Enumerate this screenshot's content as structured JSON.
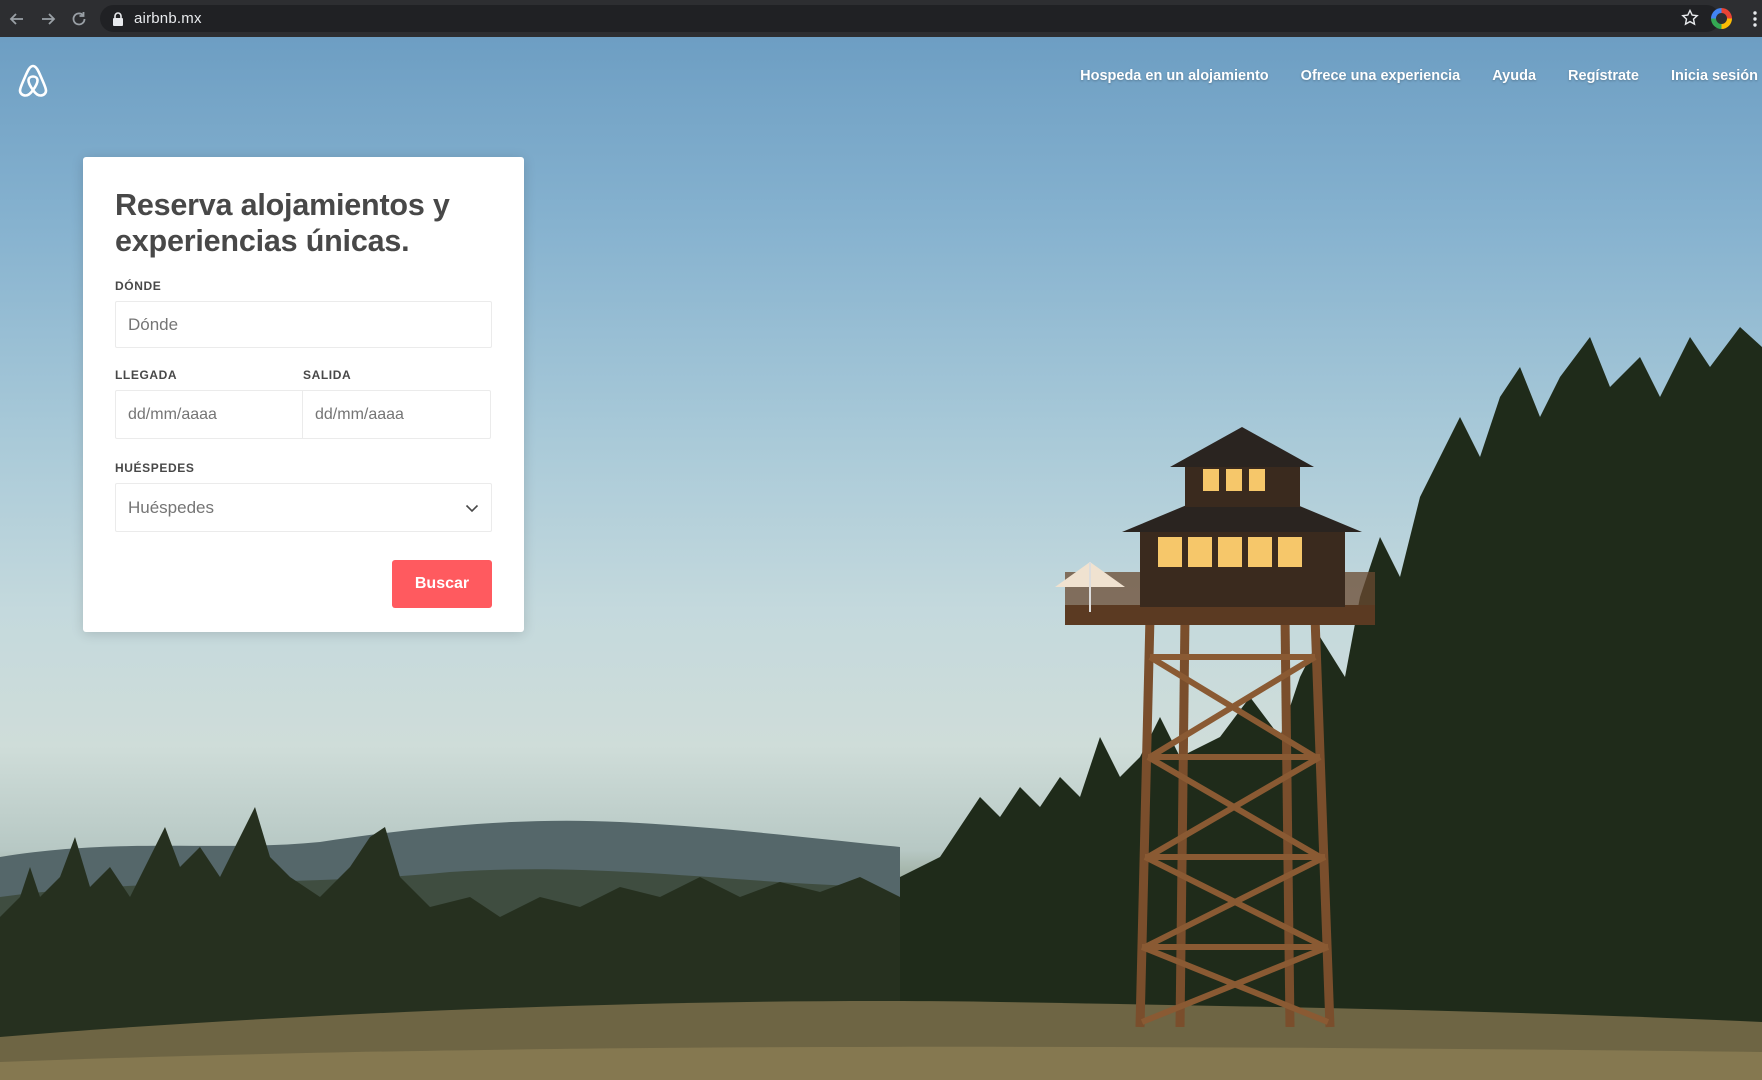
{
  "browser": {
    "url": "airbnb.mx",
    "back_icon": "arrow-left-icon",
    "forward_icon": "arrow-right-icon",
    "reload_icon": "reload-icon",
    "lock_icon": "lock-icon",
    "star_icon": "star-icon",
    "menu_icon": "vertical-dots-icon"
  },
  "header": {
    "logo_icon": "airbnb-belo-icon",
    "nav": [
      {
        "label": "Hospeda en un alojamiento"
      },
      {
        "label": "Ofrece una experiencia"
      },
      {
        "label": "Ayuda"
      },
      {
        "label": "Regístrate"
      },
      {
        "label": "Inicia sesión"
      }
    ]
  },
  "search": {
    "title": "Reserva alojamientos y experiencias únicas.",
    "where_label": "DÓNDE",
    "where_placeholder": "Dónde",
    "checkin_label": "LLEGADA",
    "checkin_placeholder": "dd/mm/aaaa",
    "checkout_label": "SALIDA",
    "checkout_placeholder": "dd/mm/aaaa",
    "guests_label": "HUÉSPEDES",
    "guests_value": "Huéspedes",
    "submit_label": "Buscar"
  },
  "colors": {
    "brand": "#ff5a5f",
    "text": "#484848"
  }
}
